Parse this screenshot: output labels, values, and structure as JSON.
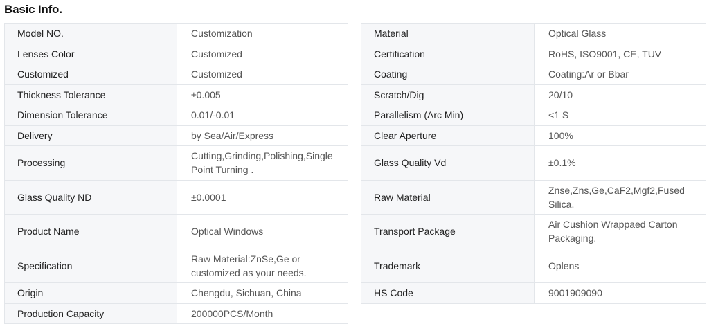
{
  "title": "Basic Info.",
  "left_rows": [
    {
      "label": "Model NO.",
      "value": "Customization"
    },
    {
      "label": "Lenses Color",
      "value": "Customized"
    },
    {
      "label": "Customized",
      "value": "Customized"
    },
    {
      "label": "Thickness Tolerance",
      "value": "±0.005"
    },
    {
      "label": "Dimension Tolerance",
      "value": "0.01/-0.01"
    },
    {
      "label": "Delivery",
      "value": "by Sea/Air/Express"
    },
    {
      "label": "Processing",
      "value": "Cutting,Grinding,Polishing,Single Point Turning ."
    },
    {
      "label": "Glass Quality ND",
      "value": "±0.0001"
    },
    {
      "label": "Product Name",
      "value": "Optical Windows"
    },
    {
      "label": "Specification",
      "value": "Raw Material:ZnSe,Ge or customized as your needs."
    },
    {
      "label": "Origin",
      "value": "Chengdu, Sichuan, China"
    },
    {
      "label": "Production Capacity",
      "value": "200000PCS/Month"
    }
  ],
  "right_rows": [
    {
      "label": "Material",
      "value": "Optical Glass"
    },
    {
      "label": "Certification",
      "value": "RoHS, ISO9001, CE, TUV"
    },
    {
      "label": "Coating",
      "value": "Coating:Ar or Bbar"
    },
    {
      "label": "Scratch/Dig",
      "value": "20/10"
    },
    {
      "label": "Parallelism (Arc Min)",
      "value": "<1 S"
    },
    {
      "label": "Clear Aperture",
      "value": "100%"
    },
    {
      "label": "Glass Quality Vd",
      "value": "±0.1%"
    },
    {
      "label": "Raw Material",
      "value": "Znse,Zns,Ge,CaF2,Mgf2,Fused Silica."
    },
    {
      "label": "Transport Package",
      "value": "Air Cushion Wrappaed Carton Packaging."
    },
    {
      "label": "Trademark",
      "value": "Oplens"
    },
    {
      "label": "HS Code",
      "value": "9001909090"
    }
  ]
}
